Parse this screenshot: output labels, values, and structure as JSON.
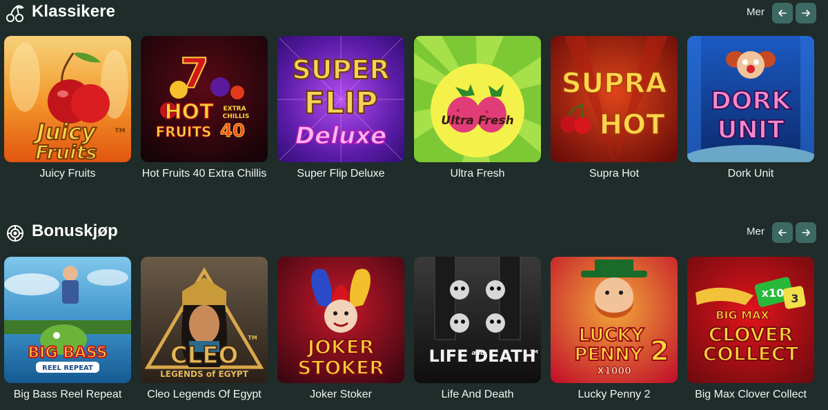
{
  "sections": [
    {
      "title": "Klassikere",
      "icon": "cherries-icon",
      "more_label": "Mer",
      "games": [
        {
          "name": "Juicy Fruits",
          "art": [
            "Juicy",
            "Fruits",
            "TM"
          ]
        },
        {
          "name": "Hot Fruits 40 Extra Chillis",
          "art": [
            "HOT",
            "EXTRA",
            "CHILLIS",
            "FRUITS",
            "40"
          ]
        },
        {
          "name": "Super Flip Deluxe",
          "art": [
            "SUPER",
            "FLIP",
            "Deluxe"
          ]
        },
        {
          "name": "Ultra Fresh",
          "art": [
            "Ultra Fresh"
          ]
        },
        {
          "name": "Supra Hot",
          "art": [
            "SUPRA",
            "HOT"
          ]
        },
        {
          "name": "Dork Unit",
          "art": [
            "DORK",
            "UNIT"
          ]
        }
      ]
    },
    {
      "title": "Bonuskjøp",
      "icon": "target-icon",
      "more_label": "Mer",
      "games": [
        {
          "name": "Big Bass Reel Repeat",
          "art": [
            "BIG BASS",
            "REEL REPEAT"
          ]
        },
        {
          "name": "Cleo Legends Of Egypt",
          "art": [
            "CLEO",
            "TM",
            "LEGENDS of EGYPT"
          ]
        },
        {
          "name": "Joker Stoker",
          "art": [
            "JOKER",
            "STOKER"
          ]
        },
        {
          "name": "Life And Death",
          "art": [
            "LIFE",
            "and",
            "DEATH",
            "TM"
          ]
        },
        {
          "name": "Lucky Penny 2",
          "art": [
            "LUCKY",
            "PENNY",
            "2",
            "X1000"
          ]
        },
        {
          "name": "Big Max Clover Collect",
          "art": [
            "BIG MAX",
            "CLOVER",
            "COLLECT",
            "x10",
            "3"
          ]
        }
      ]
    }
  ]
}
